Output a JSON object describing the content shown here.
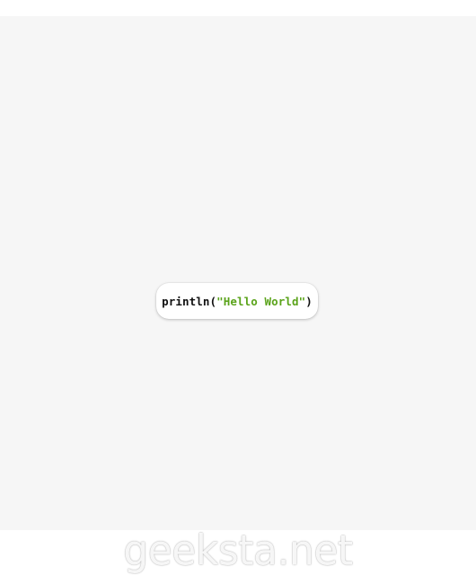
{
  "sticker": {
    "code_function": "println(",
    "code_string": "\"Hello World\"",
    "code_close": ")"
  },
  "watermark": {
    "text": "geeksta.net"
  },
  "colors": {
    "background": "#f6f6f6",
    "string_green": "#5aa31a",
    "code_black": "#111111"
  }
}
